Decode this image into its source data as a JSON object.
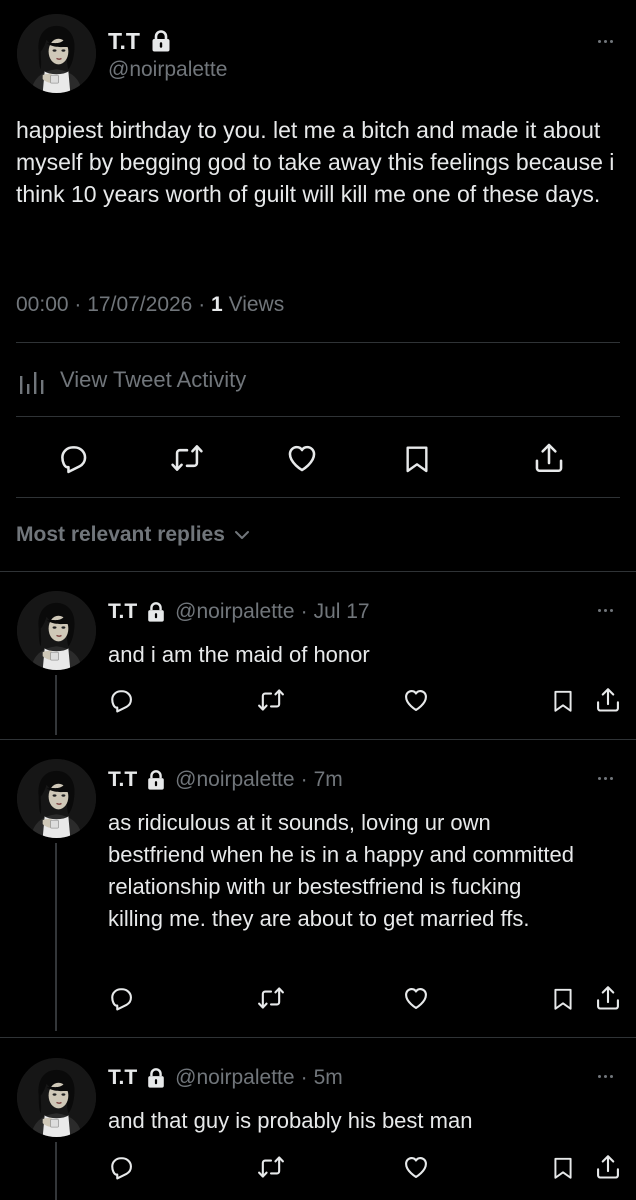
{
  "main_tweet": {
    "display_name": "T.T",
    "handle": "@noirpalette",
    "text": "happiest birthday to you. let me a bitch and made it about myself by begging god to take away this feelings because i think 10 years worth of guilt will kill me one of these days.",
    "time": "00:00",
    "sep1": "·",
    "date": "17/07/2026",
    "sep2": "·",
    "views_count": "1",
    "views_label": " Views",
    "activity_label": "View Tweet Activity"
  },
  "replies_sort_label": "Most relevant replies",
  "replies": [
    {
      "display_name": "T.T",
      "handle": "@noirpalette",
      "sep": "·",
      "time": "Jul 17",
      "text": "and i am the maid of honor"
    },
    {
      "display_name": "T.T",
      "handle": "@noirpalette",
      "sep": "·",
      "time": "7m",
      "text": "as ridiculous at it sounds, loving ur own bestfriend when he is in a happy and committed relationship with ur bestestfriend is fucking killing me. they are about to get married ffs."
    },
    {
      "display_name": "T.T",
      "handle": "@noirpalette",
      "sep": "·",
      "time": "5m",
      "text": "and that guy is probably his best man"
    }
  ],
  "colors": {
    "background": "#000000",
    "text": "#e7e9ea",
    "muted": "#71767b",
    "divider": "#2f3336"
  },
  "icons": [
    "lock-icon",
    "more-icon",
    "reply-icon",
    "retweet-icon",
    "like-icon",
    "bookmark-icon",
    "share-icon",
    "chart-icon",
    "chevron-down-icon"
  ]
}
